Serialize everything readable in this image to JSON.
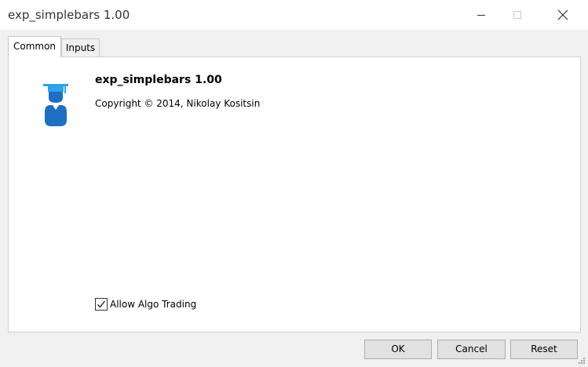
{
  "window": {
    "title": "exp_simplebars 1.00"
  },
  "tabs": [
    {
      "label": "Common",
      "active": true
    },
    {
      "label": "Inputs",
      "active": false
    }
  ],
  "common": {
    "app_name": "exp_simplebars 1.00",
    "copyright": "Copyright © 2014, Nikolay Kositsin",
    "icon": "expert-advisor-icon",
    "allow_algo_trading": {
      "label": "Allow Algo Trading",
      "checked": true
    }
  },
  "buttons": {
    "ok": "OK",
    "cancel": "Cancel",
    "reset": "Reset"
  },
  "colors": {
    "icon_blue": "#1e6fc4",
    "icon_light_blue": "#2ea3e8"
  }
}
